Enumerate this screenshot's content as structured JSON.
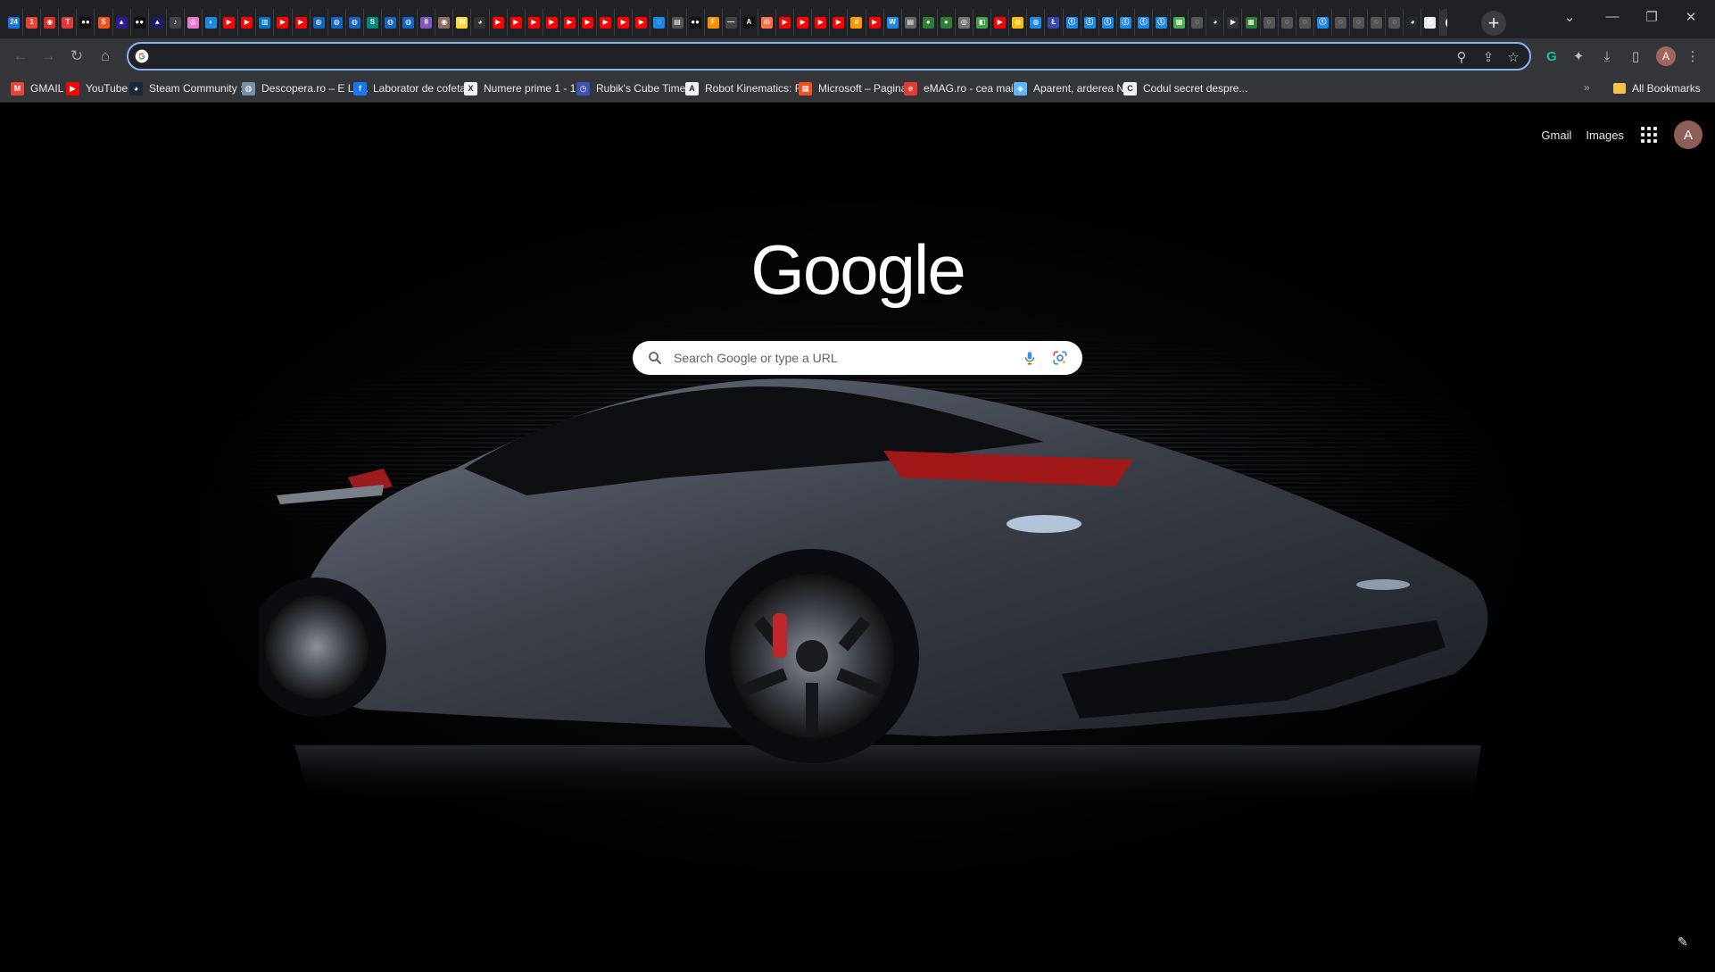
{
  "tab_strip": {
    "tab_favicons": [
      {
        "color": "#1a73e8",
        "glyph": "24"
      },
      {
        "color": "#ea4335",
        "glyph": "1"
      },
      {
        "color": "#d93025",
        "glyph": "◉"
      },
      {
        "color": "#e53935",
        "glyph": "T"
      },
      {
        "color": "#111111",
        "glyph": "●●"
      },
      {
        "color": "#f4511e",
        "glyph": "S"
      },
      {
        "color": "#311b92",
        "glyph": "▲"
      },
      {
        "color": "#111111",
        "glyph": "●●"
      },
      {
        "color": "#1c1c6b",
        "glyph": "▲"
      },
      {
        "color": "#444444",
        "glyph": "♪"
      },
      {
        "color": "#e879c9",
        "glyph": "◎"
      },
      {
        "color": "#1e88e5",
        "glyph": "◐"
      },
      {
        "color": "#ff0000",
        "glyph": "▶"
      },
      {
        "color": "#ff0000",
        "glyph": "▶"
      },
      {
        "color": "#0277bd",
        "glyph": "▥"
      },
      {
        "color": "#ff0000",
        "glyph": "▶"
      },
      {
        "color": "#ff0000",
        "glyph": "▶"
      },
      {
        "color": "#1565c0",
        "glyph": "◍"
      },
      {
        "color": "#1565c0",
        "glyph": "◍"
      },
      {
        "color": "#1565c0",
        "glyph": "◍"
      },
      {
        "color": "#00897b",
        "glyph": "S"
      },
      {
        "color": "#1565c0",
        "glyph": "◍"
      },
      {
        "color": "#1565c0",
        "glyph": "◍"
      },
      {
        "color": "#7e57c2",
        "glyph": "θ"
      },
      {
        "color": "#8d6e63",
        "glyph": "◉"
      },
      {
        "color": "#fdd835",
        "glyph": "W"
      },
      {
        "color": "#333333",
        "glyph": "◕"
      },
      {
        "color": "#ff0000",
        "glyph": "▶"
      },
      {
        "color": "#ff0000",
        "glyph": "▶"
      },
      {
        "color": "#ff0000",
        "glyph": "▶"
      },
      {
        "color": "#ff0000",
        "glyph": "▶"
      },
      {
        "color": "#ff0000",
        "glyph": "▶"
      },
      {
        "color": "#ff0000",
        "glyph": "▶"
      },
      {
        "color": "#ff0000",
        "glyph": "▶"
      },
      {
        "color": "#ff0000",
        "glyph": "▶"
      },
      {
        "color": "#ff0000",
        "glyph": "▶"
      },
      {
        "color": "#1e88e5",
        "glyph": "◌"
      },
      {
        "color": "#555555",
        "glyph": "▤"
      },
      {
        "color": "#111111",
        "glyph": "●●"
      },
      {
        "color": "#ff8f00",
        "glyph": "F"
      },
      {
        "color": "#444444",
        "glyph": "—"
      },
      {
        "color": "#111111",
        "glyph": "A"
      },
      {
        "color": "#ff7043",
        "glyph": "ılı"
      },
      {
        "color": "#ff0000",
        "glyph": "▶"
      },
      {
        "color": "#ff0000",
        "glyph": "▶"
      },
      {
        "color": "#ff0000",
        "glyph": "▶"
      },
      {
        "color": "#ff0000",
        "glyph": "▶"
      },
      {
        "color": "#ff9800",
        "glyph": "ıl"
      },
      {
        "color": "#ff0000",
        "glyph": "▶"
      },
      {
        "color": "#1e88e5",
        "glyph": "W"
      },
      {
        "color": "#666666",
        "glyph": "▤"
      },
      {
        "color": "#2e7d32",
        "glyph": "●"
      },
      {
        "color": "#2e7d32",
        "glyph": "●"
      },
      {
        "color": "#757575",
        "glyph": "◎"
      },
      {
        "color": "#43a047",
        "glyph": "◧"
      },
      {
        "color": "#ff0000",
        "glyph": "▶"
      },
      {
        "color": "#fbbc04",
        "glyph": "◍"
      },
      {
        "color": "#1e88e5",
        "glyph": "◍"
      },
      {
        "color": "#3949ab",
        "glyph": "Ł"
      },
      {
        "color": "#1e88e5",
        "glyph": "ⓣ"
      },
      {
        "color": "#1e88e5",
        "glyph": "ⓣ"
      },
      {
        "color": "#1e88e5",
        "glyph": "ⓣ"
      },
      {
        "color": "#1e88e5",
        "glyph": "ⓣ"
      },
      {
        "color": "#1e88e5",
        "glyph": "ⓣ"
      },
      {
        "color": "#1e88e5",
        "glyph": "ⓣ"
      },
      {
        "color": "#4caf50",
        "glyph": "▦"
      },
      {
        "color": "#555555",
        "glyph": "◌"
      },
      {
        "color": "#24292e",
        "glyph": "◕"
      },
      {
        "color": "#333333",
        "glyph": "▶"
      },
      {
        "color": "#2e7d32",
        "glyph": "▦"
      },
      {
        "color": "#555555",
        "glyph": "◌"
      },
      {
        "color": "#555555",
        "glyph": "◌"
      },
      {
        "color": "#555555",
        "glyph": "◌"
      },
      {
        "color": "#1e88e5",
        "glyph": "ⓣ"
      },
      {
        "color": "#555555",
        "glyph": "◌"
      },
      {
        "color": "#555555",
        "glyph": "◌"
      },
      {
        "color": "#555555",
        "glyph": "◌"
      },
      {
        "color": "#555555",
        "glyph": "◌"
      },
      {
        "color": "#24292e",
        "glyph": "◕"
      },
      {
        "color": "#e8eaed",
        "glyph": "G"
      }
    ],
    "active_tab_glyph": "G",
    "close_glyph": "✕",
    "new_tab_glyph": "+",
    "window_controls": {
      "tab_search": "⌄",
      "minimize": "—",
      "restore": "❐",
      "close": "✕"
    }
  },
  "toolbar": {
    "back_glyph": "←",
    "forward_glyph": "→",
    "reload_glyph": "↻",
    "home_glyph": "⌂",
    "omnibox_value": "",
    "omnibox_icons": {
      "zoom": "⚲",
      "share": "⇪",
      "bookmark": "☆"
    },
    "extension_icons": {
      "grammarly": "G",
      "extensions": "✦",
      "downloads": "⤓",
      "side_panel": "▯",
      "menu": "⋮"
    },
    "profile_initial": "A",
    "accent": "#8ab4f8"
  },
  "bookmarks": {
    "items": [
      {
        "label": "GMAIL",
        "icon_color": "#ea4335",
        "glyph": "M"
      },
      {
        "label": "YouTube",
        "icon_color": "#ff0000",
        "glyph": "▶"
      },
      {
        "label": "Steam Community :...",
        "icon_color": "#1b2838",
        "glyph": "◕"
      },
      {
        "label": "Descopera.ro – E Lu...",
        "icon_color": "#7a8fa6",
        "glyph": "◍"
      },
      {
        "label": "Laborator de cofeta...",
        "icon_color": "#1877f2",
        "glyph": "f"
      },
      {
        "label": "Numere prime 1 - 1...",
        "icon_color": "#f1f3f4",
        "glyph": "X"
      },
      {
        "label": "Rubik's Cube Timer...",
        "icon_color": "#3f51b5",
        "glyph": "◷"
      },
      {
        "label": "Robot Kinematics: F...",
        "icon_color": "#f1f3f4",
        "glyph": "A"
      },
      {
        "label": "Microsoft – Pagina...",
        "icon_color": "#f25022",
        "glyph": "▦"
      },
      {
        "label": "eMAG.ro - cea mai...",
        "icon_color": "#e53935",
        "glyph": "e"
      },
      {
        "label": "Aparent, arderea N...",
        "icon_color": "#64b5f6",
        "glyph": "◈"
      },
      {
        "label": "Codul secret despre...",
        "icon_color": "#f1f3f4",
        "glyph": "C"
      }
    ],
    "overflow_glyph": "»",
    "all_bookmarks_label": "All Bookmarks"
  },
  "ntp": {
    "gmail_label": "Gmail",
    "images_label": "Images",
    "account_initial": "A",
    "logo_text": "Google",
    "search_placeholder": "Search Google or type a URL",
    "customize_glyph": "✎"
  }
}
